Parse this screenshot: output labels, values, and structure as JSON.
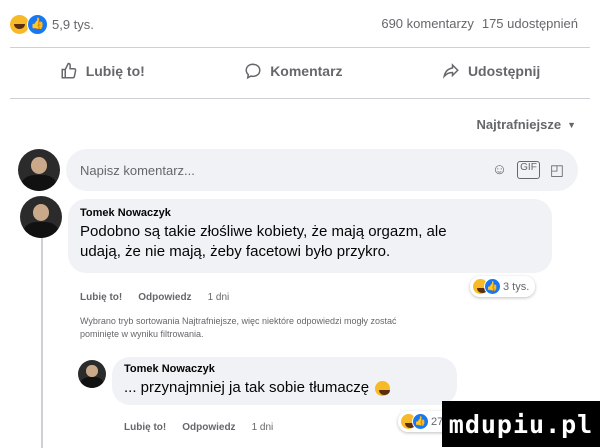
{
  "stats": {
    "reactions_count": "5,9 tys.",
    "comments": "690 komentarzy",
    "shares": "175 udostępnień"
  },
  "actions": {
    "like": "Lubię to!",
    "comment": "Komentarz",
    "share": "Udostępnij"
  },
  "sort": {
    "label": "Najtrafniejsze"
  },
  "composer": {
    "placeholder": "Napisz komentarz..."
  },
  "comments": [
    {
      "author": "Tomek Nowaczyk",
      "line1": "Podobno są takie złośliwe kobiety, że mają orgazm, ale",
      "line2": "udają, że nie mają, żeby facetowi było przykro.",
      "like": "Lubię to!",
      "reply": "Odpowiedz",
      "time": "1 dni",
      "reactions": "3 tys."
    },
    {
      "author": "Tomek Nowaczyk",
      "text": "... przynajmniej ja tak sobie tłumaczę",
      "like": "Lubię to!",
      "reply": "Odpowiedz",
      "time": "1 dni",
      "reactions": "274"
    }
  ],
  "filter_notice": {
    "line1": "Wybrano tryb sortowania Najtrafniejsze, więc niektóre odpowiedzi mogły zostać",
    "line2": "pominięte w wyniku filtrowania."
  },
  "watermark": "mdupiu.pl",
  "colors": {
    "like_blue": "#1877f2",
    "haha_yellow": "#f7b928",
    "muted": "#65676b",
    "bubble": "#f0f2f5"
  }
}
